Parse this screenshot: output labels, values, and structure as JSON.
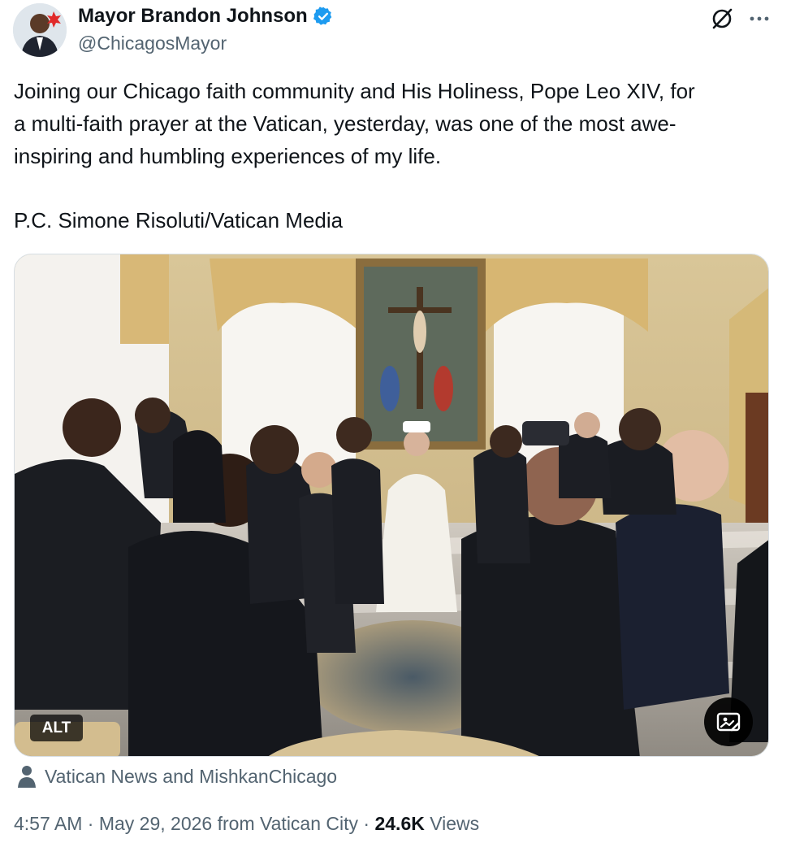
{
  "author": {
    "display_name": "Mayor Brandon Johnson",
    "handle": "@ChicagosMayor"
  },
  "tweet": {
    "text_line_1": "Joining our Chicago faith community and His Holiness, Pope Leo XIV, for",
    "text_line_2": "a multi-faith prayer at the Vatican, yesterday, was one of the most awe-",
    "text_line_3": "inspiring and humbling experiences of my life.",
    "photo_credit": "P.C. Simone Risoluti/Vatican Media"
  },
  "media": {
    "alt_label": "ALT"
  },
  "tagged": {
    "text": "Vatican News and MishkanChicago"
  },
  "meta": {
    "time": "4:57 AM",
    "separator_1": " · ",
    "date": "May 29, 2026",
    "location": " from Vatican City",
    "separator_2": " · ",
    "views_count": "24.6K",
    "views_label": " Views"
  },
  "icons": {
    "verified": "verified-badge-icon",
    "grok": "grok-icon",
    "more": "more-icon",
    "tag_people": "tag-people-icon",
    "person": "person-icon"
  },
  "colors": {
    "verified_blue": "#1d9bf0",
    "text_primary": "#0f1419",
    "text_secondary": "#536471"
  }
}
